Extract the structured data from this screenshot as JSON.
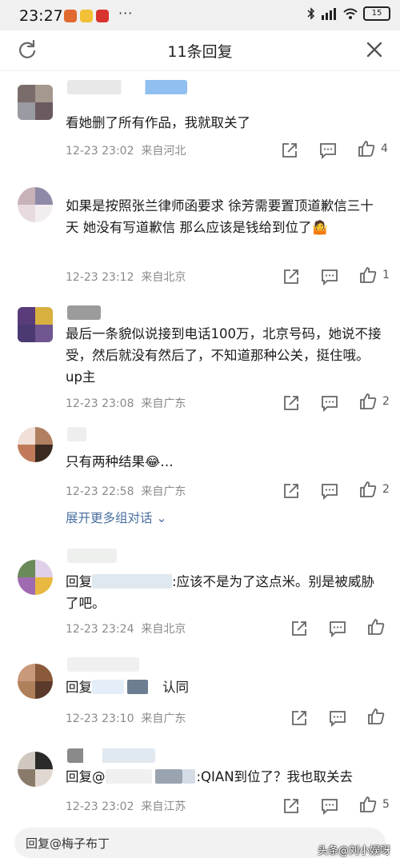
{
  "status": {
    "time": "23:27",
    "battery": "15"
  },
  "header": {
    "title": "11条回复"
  },
  "comments": [
    {
      "text": "看她删了所有作品，我就取关了",
      "time": "12-23 23:02",
      "location": "来自河北",
      "likes": "4"
    },
    {
      "text": "如果是按照张兰律师函要求 徐芳需要置顶道歉信三十天 她没有写道歉信 那么应该是钱给到位了🤷",
      "time": "12-23 23:12",
      "location": "来自北京",
      "likes": "1"
    },
    {
      "text": "最后一条貌似说接到电话100万，北京号码，她说不接受，然后就没有然后了，不知道那种公关，挺住哦。up主",
      "time": "12-23 23:08",
      "location": "来自广东",
      "likes": "2"
    },
    {
      "text": "只有两种结果😂…",
      "time": "12-23 22:58",
      "location": "来自广东",
      "likes": "2"
    },
    {
      "reply_prefix": "回复",
      "text": ":应该不是为了这点米。别是被威胁了吧。",
      "time": "12-23 23:24",
      "location": "来自北京",
      "likes": ""
    },
    {
      "reply_prefix": "回复",
      "text": "认同",
      "time": "12-23 23:10",
      "location": "来自广东",
      "likes": ""
    },
    {
      "reply_prefix": "回复@",
      "text": ":QIAN到位了？我也取关去",
      "time": "12-23 23:02",
      "location": "来自江苏",
      "likes": "5"
    }
  ],
  "expand_label": "展开更多组对话",
  "reply_bar": {
    "placeholder": "回复@梅子布丁"
  },
  "watermark": "头条@刘小娱呀",
  "icons": {
    "refresh": "refresh-icon",
    "close": "close-icon",
    "share": "share-icon",
    "comment": "comment-icon",
    "like": "thumbs-up-icon"
  }
}
